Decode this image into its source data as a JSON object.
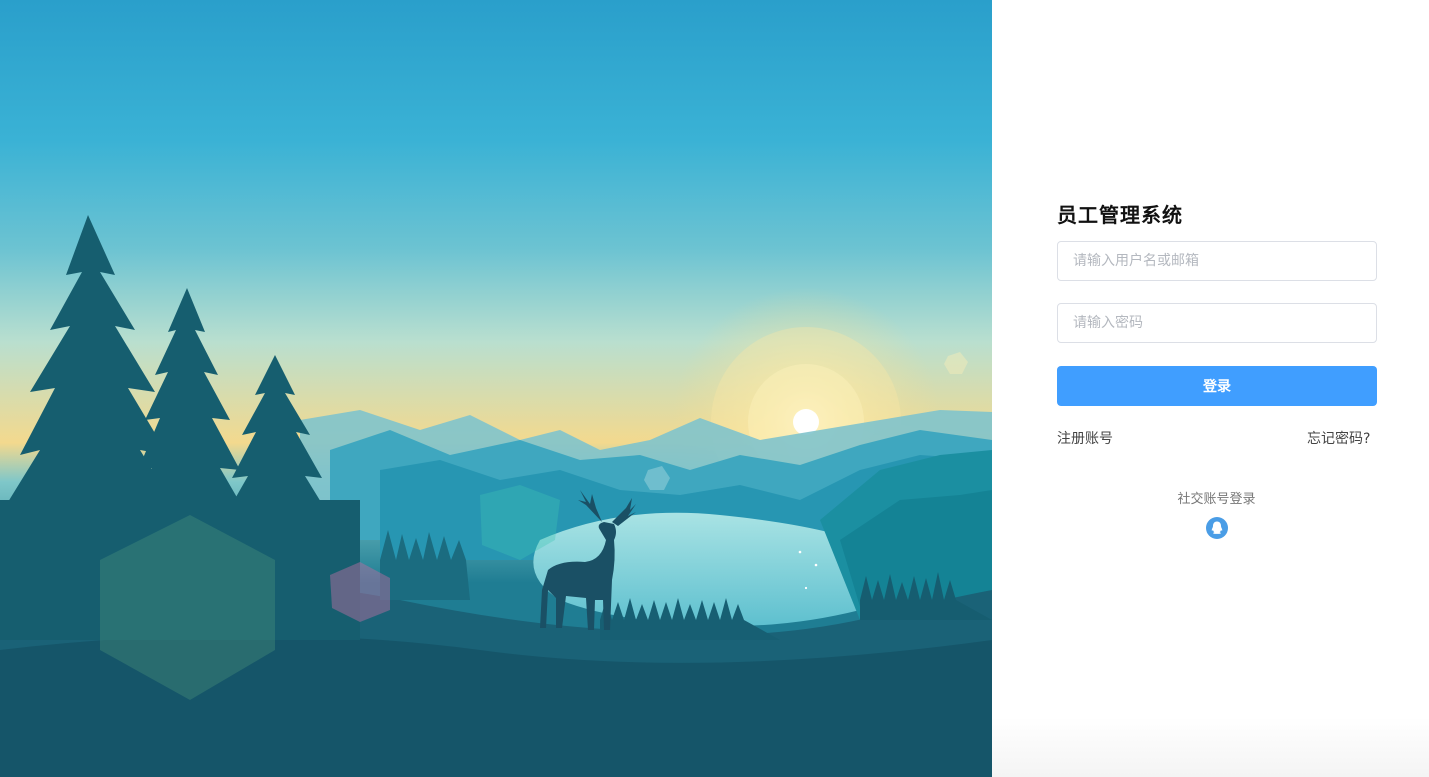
{
  "login": {
    "title": "员工管理系统",
    "username_placeholder": "请输入用户名或邮箱",
    "password_placeholder": "请输入密码",
    "submit_label": "登录",
    "register_label": "注册账号",
    "forgot_label": "忘记密码?",
    "social_label": "社交账号登录"
  },
  "colors": {
    "primary": "#409eff",
    "qq_icon": "#4a9de6"
  },
  "icons": {
    "social": "qq-icon"
  }
}
